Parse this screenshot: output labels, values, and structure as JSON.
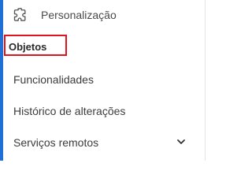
{
  "menu": {
    "personalizacao": {
      "label": "Personalização",
      "icon": "puzzle-icon"
    },
    "objetos": {
      "label": "Objetos",
      "highlighted": true,
      "highlight_color": "#e0131e"
    },
    "funcionalidades": {
      "label": "Funcionalidades"
    },
    "historico": {
      "label": "Histórico de alterações"
    },
    "servicos": {
      "label": "Serviços remotos",
      "icon": "chevron-down-icon",
      "expanded": false
    }
  },
  "colors": {
    "accent": "#1f6fd6",
    "text": "#3c3c3c",
    "highlight": "#e0131e"
  }
}
